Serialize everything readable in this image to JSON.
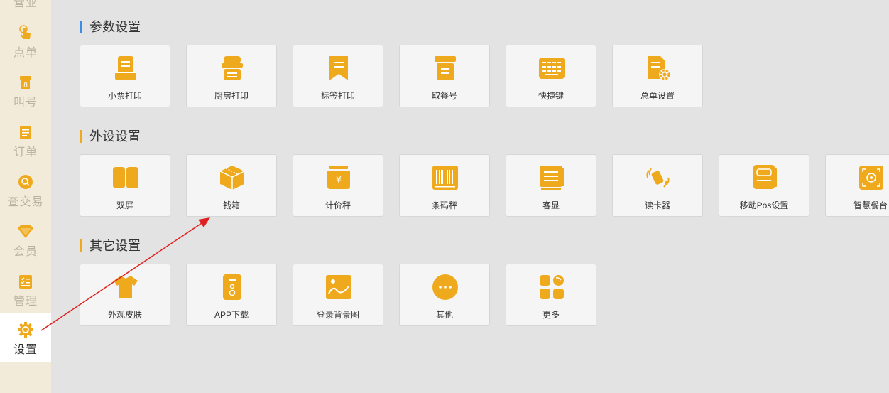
{
  "colors": {
    "accent": "#efa91d",
    "blue_bar": "#3a8ee6",
    "arrow": "#e02020"
  },
  "sidebar": {
    "items": [
      {
        "label": "营业",
        "icon": "store-icon"
      },
      {
        "label": "点单",
        "icon": "hand-pointer-icon"
      },
      {
        "label": "叫号",
        "icon": "call-number-icon"
      },
      {
        "label": "订单",
        "icon": "order-list-icon"
      },
      {
        "label": "查交易",
        "icon": "search-icon"
      },
      {
        "label": "会员",
        "icon": "diamond-icon"
      },
      {
        "label": "管理",
        "icon": "checklist-icon"
      },
      {
        "label": "设置",
        "icon": "gear-icon",
        "active": true
      }
    ]
  },
  "sections": [
    {
      "title": "参数设置",
      "items": [
        {
          "label": "小票打印",
          "icon": "receipt-printer-icon"
        },
        {
          "label": "厨房打印",
          "icon": "kitchen-printer-icon"
        },
        {
          "label": "标签打印",
          "icon": "label-printer-icon"
        },
        {
          "label": "取餐号",
          "icon": "pickup-number-icon"
        },
        {
          "label": "快捷键",
          "icon": "keyboard-icon"
        },
        {
          "label": "总单设置",
          "icon": "document-settings-icon"
        }
      ]
    },
    {
      "title": "外设设置",
      "items": [
        {
          "label": "双屏",
          "icon": "dual-screen-icon"
        },
        {
          "label": "钱箱",
          "icon": "cash-box-icon"
        },
        {
          "label": "计价秤",
          "icon": "pricing-scale-icon"
        },
        {
          "label": "条码秤",
          "icon": "barcode-scale-icon"
        },
        {
          "label": "客显",
          "icon": "customer-display-icon"
        },
        {
          "label": "读卡器",
          "icon": "card-reader-icon"
        },
        {
          "label": "移动Pos设置",
          "icon": "mobile-pos-icon"
        },
        {
          "label": "智慧餐台",
          "icon": "smart-table-icon"
        }
      ]
    },
    {
      "title": "其它设置",
      "items": [
        {
          "label": "外观皮肤",
          "icon": "tshirt-icon"
        },
        {
          "label": "APP下载",
          "icon": "app-download-icon"
        },
        {
          "label": "登录背景图",
          "icon": "image-icon"
        },
        {
          "label": "其他",
          "icon": "more-dots-icon"
        },
        {
          "label": "更多",
          "icon": "apps-grid-icon"
        }
      ]
    }
  ]
}
